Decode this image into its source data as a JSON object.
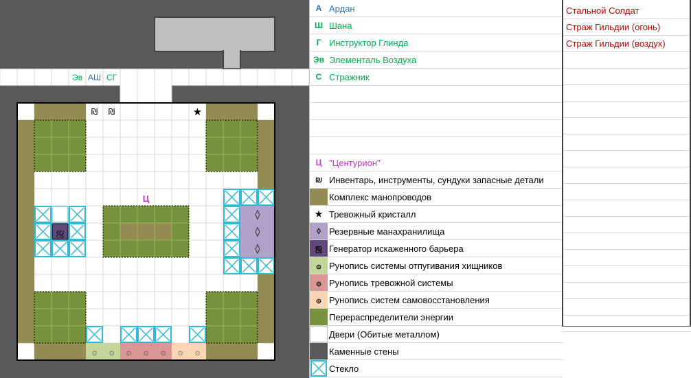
{
  "map": {
    "labels": {
      "ev": "Эв",
      "ash": "АШ",
      "sg": "СГ",
      "centurion": "Ц"
    },
    "colors": {
      "stone": "#595959",
      "conduit": "#948a54",
      "energy": "#76923c",
      "glass": "#31b9d5",
      "mana": "#b1a0c7",
      "barrier": "#60497a",
      "rune_predator": "#c4d79b",
      "rune_alarm": "#da9694",
      "rune_repair": "#fcd5b4",
      "grid": "#d9d9d9"
    }
  },
  "legend": [
    {
      "symbol": "А",
      "text": "Ардан",
      "color": "#2e75b6"
    },
    {
      "symbol": "Ш",
      "text": "Шана",
      "color": "#00b050"
    },
    {
      "symbol": "Г",
      "text": "Инструктор Глинда",
      "color": "#00b050"
    },
    {
      "symbol": "Эв",
      "text": "Элементаль Воздуха",
      "color": "#00b050"
    },
    {
      "symbol": "С",
      "text": "Стражник",
      "color": "#00b050"
    },
    {
      "symbol": "",
      "text": "",
      "color": "#000000"
    },
    {
      "symbol": "",
      "text": "",
      "color": "#000000"
    },
    {
      "symbol": "",
      "text": "",
      "color": "#000000"
    },
    {
      "symbol": "",
      "text": "",
      "color": "#000000"
    },
    {
      "symbol": "Ц",
      "text": "\"Центурион\"",
      "color": "#cc33cc"
    },
    {
      "symbol": "₪",
      "text": "Инвентарь, инструменты, сундуки запасные детали",
      "color": "#000000",
      "icon": "inventory-icon"
    },
    {
      "symbol": "",
      "text": "Комплекс манопроводов",
      "color": "#000000",
      "swatch": "#948a54"
    },
    {
      "symbol": "★",
      "text": "Тревожный кристалл",
      "color": "#000000",
      "icon": "star-icon"
    },
    {
      "symbol": "◊",
      "text": "Резервные манахранилища",
      "color": "#000000",
      "icon": "diamond-icon"
    },
    {
      "symbol": "ஜ",
      "text": "Генератор искаженного барьера",
      "color": "#000000",
      "icon": "barrier-icon"
    },
    {
      "symbol": "۞",
      "text": "Рунопись системы отпугивания хищников",
      "color": "#000000",
      "swatch": "#c4d79b",
      "icon": "rune-icon"
    },
    {
      "symbol": "۞",
      "text": "Рунопись тревожной системы",
      "color": "#000000",
      "swatch": "#da9694",
      "icon": "rune-icon"
    },
    {
      "symbol": "۞",
      "text": "Рунопись систем самовосстановления",
      "color": "#000000",
      "swatch": "#fcd5b4",
      "icon": "rune-icon"
    },
    {
      "symbol": "",
      "text": "Перераспределители энергии",
      "color": "#000000",
      "swatch": "#76923c"
    },
    {
      "symbol": "",
      "text": "Двери (Обитые металлом)",
      "color": "#000000",
      "swatch": "#ffffff"
    },
    {
      "symbol": "",
      "text": "Каменные стены",
      "color": "#000000",
      "swatch": "#595959"
    },
    {
      "symbol": "",
      "text": "Стекло",
      "color": "#000000",
      "swatch": "glass",
      "icon": "glass-icon"
    }
  ],
  "enemies": [
    {
      "text": "Стальной Солдат"
    },
    {
      "text": "Страж Гильдии (огонь)"
    },
    {
      "text": "Страж Гильдии (воздух)"
    }
  ]
}
